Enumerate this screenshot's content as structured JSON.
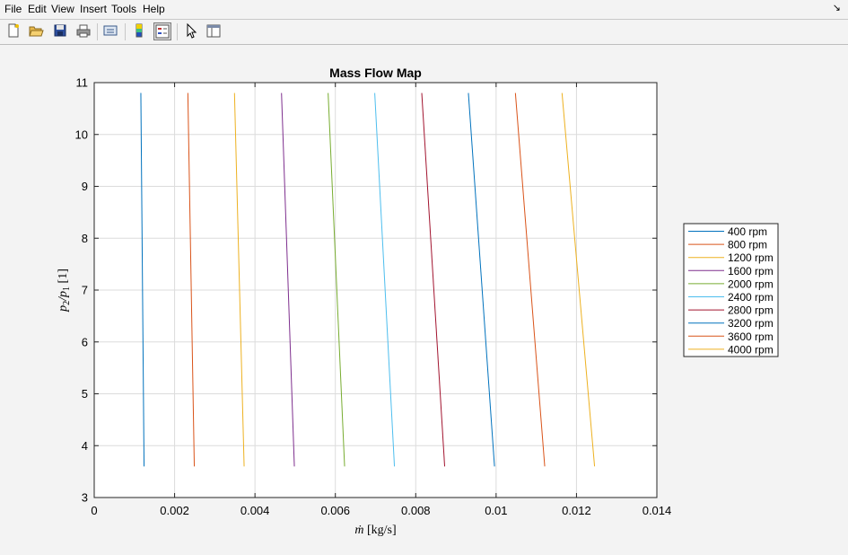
{
  "menu": {
    "file": "File",
    "edit": "Edit",
    "view": "View",
    "insert": "Insert",
    "tools": "Tools",
    "help": "Help",
    "undock_icon": "undock-arrow-icon"
  },
  "toolbar": {
    "buttons": [
      {
        "name": "new-figure-icon"
      },
      {
        "name": "open-file-icon"
      },
      {
        "name": "save-icon"
      },
      {
        "name": "print-icon"
      },
      {
        "name": "link-plot-icon"
      },
      {
        "name": "colorbar-icon"
      },
      {
        "name": "legend-icon",
        "active": true
      },
      {
        "name": "edit-plot-arrow-icon"
      },
      {
        "name": "property-inspector-icon"
      }
    ]
  },
  "chart_data": {
    "type": "line",
    "title": "Mass Flow Map",
    "xlabel_main": "ṁ",
    "xlabel_unit": " [kg/s]",
    "ylabel_p2": "p",
    "ylabel_sub2": "2",
    "ylabel_slash": "/p",
    "ylabel_sub1": "1",
    "ylabel_unit": " [1]",
    "xlim": [
      0,
      0.014
    ],
    "ylim": [
      3,
      11
    ],
    "xticks": [
      0,
      0.002,
      0.004,
      0.006,
      0.008,
      0.01,
      0.012,
      0.014
    ],
    "xtick_labels": [
      "0",
      "0.002",
      "0.004",
      "0.006",
      "0.008",
      "0.01",
      "0.012",
      "0.014"
    ],
    "yticks": [
      3,
      4,
      5,
      6,
      7,
      8,
      9,
      10,
      11
    ],
    "ytick_labels": [
      "3",
      "4",
      "5",
      "6",
      "7",
      "8",
      "9",
      "10",
      "11"
    ],
    "grid": true,
    "legend_position": "right",
    "series": [
      {
        "name": "400 rpm",
        "color": "#0072BD",
        "x": [
          0.00116,
          0.00124
        ],
        "y": [
          10.8,
          3.6
        ]
      },
      {
        "name": "800 rpm",
        "color": "#D95319",
        "x": [
          0.00233,
          0.00249
        ],
        "y": [
          10.8,
          3.6
        ]
      },
      {
        "name": "1200 rpm",
        "color": "#EDB120",
        "x": [
          0.00349,
          0.00373
        ],
        "y": [
          10.8,
          3.6
        ]
      },
      {
        "name": "1600 rpm",
        "color": "#7E2F8E",
        "x": [
          0.00466,
          0.00498
        ],
        "y": [
          10.8,
          3.6
        ]
      },
      {
        "name": "2000 rpm",
        "color": "#77AC30",
        "x": [
          0.00582,
          0.00623
        ],
        "y": [
          10.8,
          3.6
        ]
      },
      {
        "name": "2400 rpm",
        "color": "#4DBEEE",
        "x": [
          0.00698,
          0.00747
        ],
        "y": [
          10.8,
          3.6
        ]
      },
      {
        "name": "2800 rpm",
        "color": "#A2142F",
        "x": [
          0.00815,
          0.00872
        ],
        "y": [
          10.8,
          3.6
        ]
      },
      {
        "name": "3200 rpm",
        "color": "#0072BD",
        "x": [
          0.00931,
          0.00996
        ],
        "y": [
          10.8,
          3.6
        ]
      },
      {
        "name": "3600 rpm",
        "color": "#D95319",
        "x": [
          0.01048,
          0.01121
        ],
        "y": [
          10.8,
          3.6
        ]
      },
      {
        "name": "4000 rpm",
        "color": "#EDB120",
        "x": [
          0.01164,
          0.01245
        ],
        "y": [
          10.8,
          3.6
        ]
      }
    ]
  }
}
